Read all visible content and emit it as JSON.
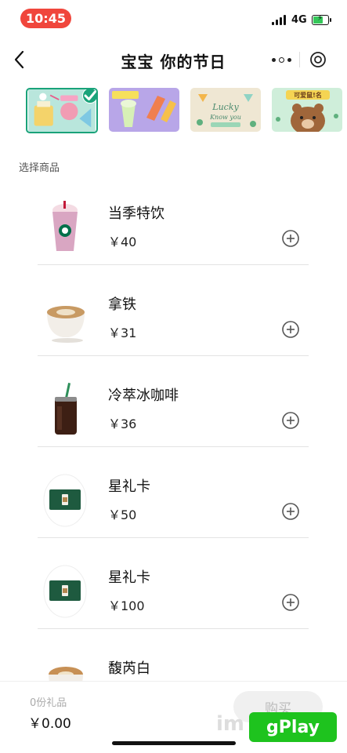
{
  "status_bar": {
    "time": "10:45",
    "network": "4G"
  },
  "nav": {
    "title": "宝宝 你的节日"
  },
  "cards": [
    {
      "selected": true,
      "theme": "party-cake"
    },
    {
      "selected": false,
      "theme": "ice-drinks"
    },
    {
      "selected": false,
      "theme": "lucky-clover",
      "text": "Lucky Know you"
    },
    {
      "selected": false,
      "theme": "bear",
      "text": "可爱鼠!名"
    }
  ],
  "card_text": {
    "lucky": "Lucky",
    "know_you": "Know you",
    "bear": "可爱鼠!名"
  },
  "section_label": "选择商品",
  "products": [
    {
      "name": "当季特饮",
      "price": "￥40",
      "thumb": "pink-frappuccino"
    },
    {
      "name": "拿铁",
      "price": "￥31",
      "thumb": "latte-cup"
    },
    {
      "name": "冷萃冰咖啡",
      "price": "￥36",
      "thumb": "cold-brew"
    },
    {
      "name": "星礼卡",
      "price": "￥50",
      "thumb": "star-gift-card"
    },
    {
      "name": "星礼卡",
      "price": "￥100",
      "thumb": "star-gift-card"
    },
    {
      "name": "馥芮白",
      "price": "",
      "thumb": "flat-white"
    }
  ],
  "bottom": {
    "gift_count": "0份礼品",
    "total": "￥0.00",
    "buy_label": "购买"
  },
  "watermark": {
    "prefix": "im",
    "brand": "gPlay"
  },
  "colors": {
    "time_pill": "#f0463c",
    "accent_green": "#1aa37a",
    "battery": "#35c759"
  }
}
